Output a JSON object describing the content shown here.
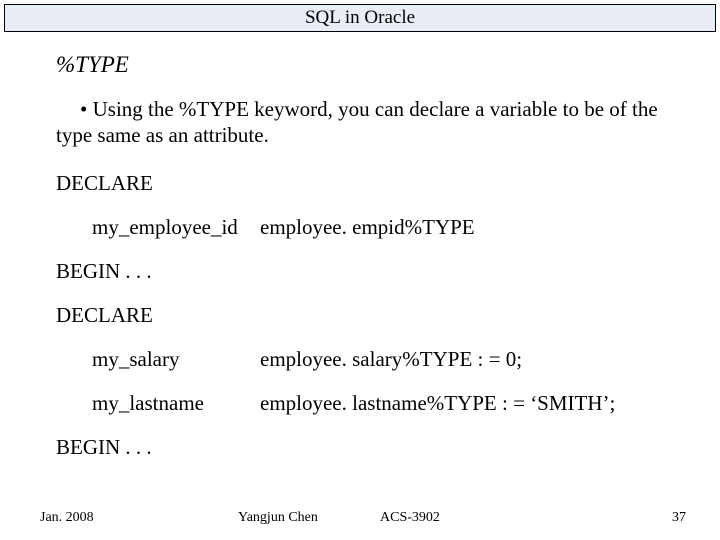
{
  "title": "SQL in Oracle",
  "heading": "%TYPE",
  "bullet": "•",
  "bullet_text": "Using the %TYPE keyword, you can declare a variable to be of the type same as an attribute.",
  "declare1": "DECLARE",
  "row1_col1": "my_employee_id",
  "row1_col2": "employee. empid%TYPE",
  "begin1": "BEGIN . . .",
  "declare2": "DECLARE",
  "row2_col1": "my_salary",
  "row2_col2": "employee. salary%TYPE : = 0;",
  "row3_col1": "my_lastname",
  "row3_col2": "employee. lastname%TYPE : = ‘SMITH’;",
  "begin2": "BEGIN . . .",
  "footer": {
    "date": "Jan. 2008",
    "author": "Yangjun Chen",
    "course": "ACS-3902",
    "page": "37"
  }
}
